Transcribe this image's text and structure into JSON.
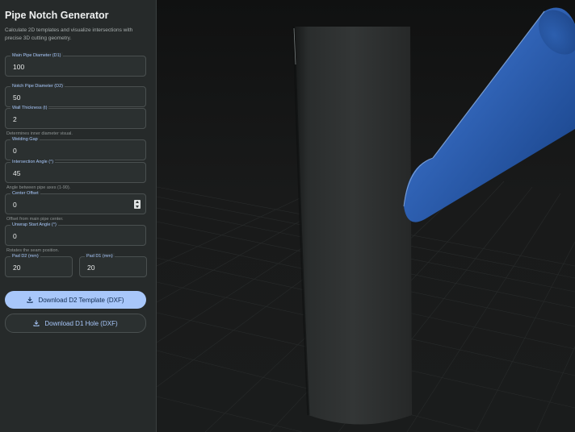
{
  "app": {
    "title": "Pipe Notch Generator",
    "description": "Calculate 2D templates and visualize intersections with precise 3D cutting geometry."
  },
  "fields": {
    "d1": {
      "label": "Main Pipe Diameter (D1)",
      "value": "100"
    },
    "d2": {
      "label": "Notch Pipe Diameter (D2)",
      "value": "50"
    },
    "thickness": {
      "label": "Wall Thickness (t)",
      "value": "2",
      "help": "Determines inner diameter visual."
    },
    "gap": {
      "label": "Welding Gap",
      "value": "0"
    },
    "angle": {
      "label": "Intersection Angle (°)",
      "value": "45",
      "help": "Angle between pipe axes (1-90)."
    },
    "offset": {
      "label": "Center Offset",
      "value": "0",
      "help": "Offset from main pipe center."
    },
    "unwrap": {
      "label": "Unwrap Start Angle (°)",
      "value": "0",
      "help": "Rotates the seam position."
    },
    "pad_d2": {
      "label": "Pad D2 (mm)",
      "value": "20"
    },
    "pad_d1": {
      "label": "Pad D1 (mm)",
      "value": "20"
    }
  },
  "buttons": {
    "download_d2": "Download D2 Template (DXF)",
    "download_d1": "Download D1 Hole (DXF)"
  },
  "icons": {
    "download": "download-icon"
  },
  "colors": {
    "accent": "#a8c7fa",
    "sidebar_bg": "#262a2a",
    "viewport_bg": "#141515",
    "main_pipe": "#2e3232",
    "notch_pipe": "#2f63b8"
  }
}
